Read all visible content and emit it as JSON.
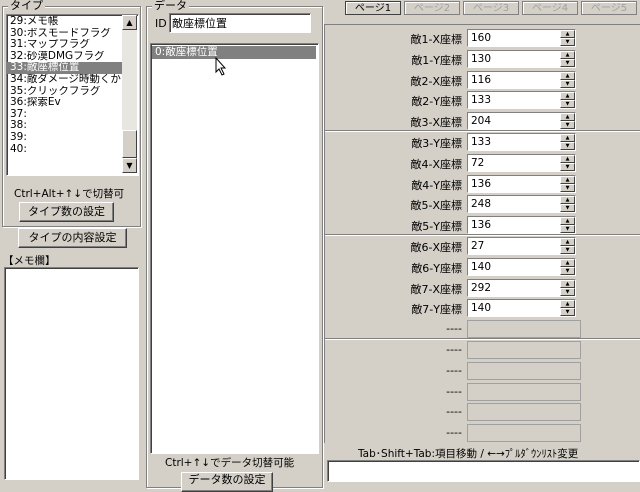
{
  "type_panel": {
    "title": "タイプ",
    "items": [
      "29:メモ帳",
      "30:ボスモードフラグ",
      "31:マップフラグ",
      "32:砂漠DMGフラグ",
      "33:敵座標位置",
      "34:敵ダメージ時動くか",
      "35:クリックフラグ",
      "36:探索Ev",
      "37:",
      "38:",
      "39:",
      "40:"
    ],
    "selected_index": 4,
    "switch_hint": "Ctrl+Alt+↑↓で切替可",
    "type_count_button": "タイプ数の設定",
    "type_content_button": "タイプの内容設定",
    "memo_label": "【メモ欄】"
  },
  "data_panel": {
    "title": "データ",
    "id_label": "ID",
    "id_value": "敵座標位置",
    "items": [
      "0:敵座標位置"
    ],
    "selected_index": 0,
    "switch_hint": "Ctrl+↑↓でデータ切替可能",
    "data_count_button": "データ数の設定"
  },
  "tabs": [
    "ページ1",
    "ページ2",
    "ページ3",
    "ページ4",
    "ページ5"
  ],
  "active_tab": 0,
  "fields": [
    {
      "label": "敵1-X座標",
      "value": "160"
    },
    {
      "label": "敵1-Y座標",
      "value": "130"
    },
    {
      "label": "敵2-X座標",
      "value": "116"
    },
    {
      "label": "敵2-Y座標",
      "value": "133"
    },
    {
      "label": "敵3-X座標",
      "value": "204"
    },
    {
      "label": "敵3-Y座標",
      "value": "133"
    },
    {
      "label": "敵4-X座標",
      "value": "72"
    },
    {
      "label": "敵4-Y座標",
      "value": "136"
    },
    {
      "label": "敵5-X座標",
      "value": "248"
    },
    {
      "label": "敵5-Y座標",
      "value": "136"
    },
    {
      "label": "敵6-X座標",
      "value": "27"
    },
    {
      "label": "敵6-Y座標",
      "value": "140"
    },
    {
      "label": "敵7-X座標",
      "value": "292"
    },
    {
      "label": "敵7-Y座標",
      "value": "140"
    }
  ],
  "empty_fields": [
    "----",
    "----",
    "----",
    "----",
    "----",
    "----"
  ],
  "bottom_hint": "Tab･Shift+Tab:項目移動 / ←→ﾌﾟﾙﾀﾞｳﾝﾘｽﾄ変更"
}
